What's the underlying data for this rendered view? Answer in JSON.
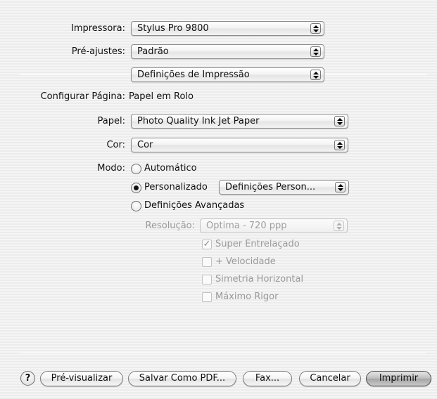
{
  "printer": {
    "label": "Impressora:",
    "value": "Stylus Pro 9800"
  },
  "presets": {
    "label": "Pré-ajustes:",
    "value": "Padrão"
  },
  "panel": {
    "value": "Definições de Impressão"
  },
  "page_setup": {
    "label": "Configurar Página:",
    "value": "Papel em Rolo"
  },
  "paper": {
    "label": "Papel:",
    "value": "Photo Quality Ink Jet Paper"
  },
  "color": {
    "label": "Cor:",
    "value": "Cor"
  },
  "mode": {
    "label": "Modo:",
    "options": [
      {
        "label": "Automático",
        "selected": false
      },
      {
        "label": "Personalizado",
        "selected": true
      },
      {
        "label": "Definições Avançadas",
        "selected": false
      }
    ],
    "custom_popup": "Definições Person..."
  },
  "resolution": {
    "label": "Resolução:",
    "value": "Optima - 720 ppp",
    "enabled": false
  },
  "checkboxes": [
    {
      "label": "Super Entrelaçado",
      "checked": true,
      "enabled": false
    },
    {
      "label": "+ Velocidade",
      "checked": false,
      "enabled": false
    },
    {
      "label": "Simetria Horizontal",
      "checked": false,
      "enabled": false
    },
    {
      "label": "Máximo Rigor",
      "checked": false,
      "enabled": false
    }
  ],
  "buttons": {
    "help": "?",
    "preview": "Pré-visualizar",
    "save_pdf": "Salvar Como PDF...",
    "fax": "Fax...",
    "cancel": "Cancelar",
    "print": "Imprimir"
  }
}
